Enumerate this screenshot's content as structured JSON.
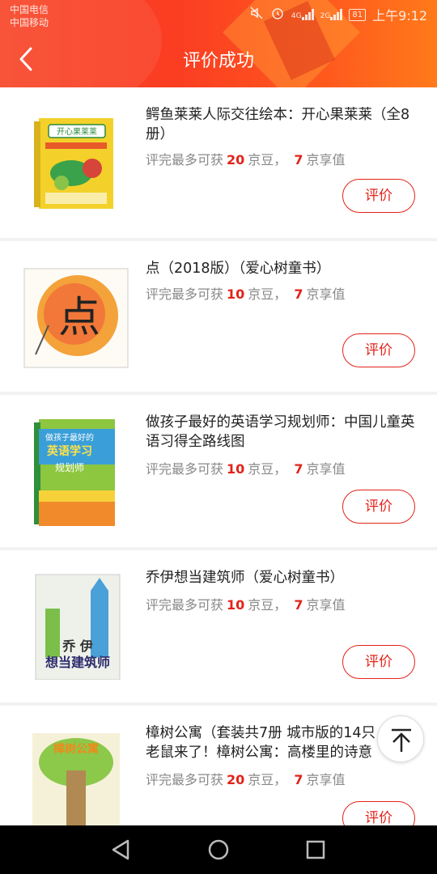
{
  "status_bar": {
    "carrier_1": "中国电信",
    "carrier_2": "中国移动",
    "network_1": "4G",
    "network_2": "2G",
    "battery": "81",
    "time": "上午9:12"
  },
  "header": {
    "title": "评价成功",
    "accent_color": "#f7472a"
  },
  "reward_text": {
    "prefix": "评完最多可获",
    "bean_unit": "京豆，",
    "value_unit": "京享值"
  },
  "items": [
    {
      "name": "鳄鱼莱莱人际交往绘本：开心果莱莱（全8册）",
      "beans": "20",
      "value": "7",
      "button": "评价"
    },
    {
      "name": "点（2018版）（爱心树童书）",
      "beans": "10",
      "value": "7",
      "button": "评价"
    },
    {
      "name": "做孩子最好的英语学习规划师：中国儿童英语习得全路线图",
      "beans": "10",
      "value": "7",
      "button": "评价"
    },
    {
      "name": "乔伊想当建筑师（爱心树童书）",
      "beans": "10",
      "value": "7",
      "button": "评价"
    },
    {
      "name": "樟树公寓（套装共7册 城市版的14只老鼠来了！樟树公寓：高楼里的诗意",
      "beans": "20",
      "value": "7",
      "button": "评价"
    }
  ],
  "covers": {
    "book1_title": "开心果莱莱",
    "book2_glyph": "点",
    "book3_title_a": "做孩子最好的",
    "book3_title_b": "英语学习",
    "book3_title_c": "规划师",
    "book4_title_a": "乔 伊",
    "book4_title_b": "想当建筑师",
    "book5_title": "樟树公寓"
  },
  "icons": {
    "back": "back-arrow-icon",
    "to_top": "arrow-to-top-icon",
    "nav_back": "triangle-back-icon",
    "nav_home": "circle-home-icon",
    "nav_recent": "square-recent-icon"
  }
}
